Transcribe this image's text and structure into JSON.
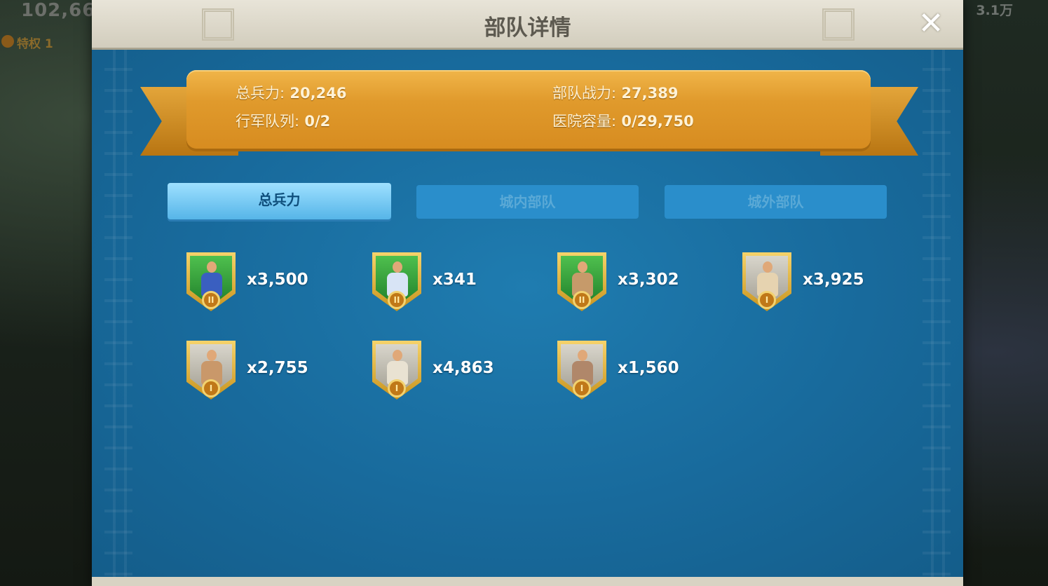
{
  "background": {
    "resource_value": "102,66",
    "vip_label": "特权 1",
    "right_value": "3.1万"
  },
  "modal": {
    "title": "部队详情",
    "close_glyph": "✕"
  },
  "summary": {
    "total_troops_label": "总兵力:",
    "total_troops_value": "20,246",
    "power_label": "部队战力:",
    "power_value": "27,389",
    "march_queue_label": "行军队列:",
    "march_queue_value": "0/2",
    "hospital_label": "医院容量:",
    "hospital_value": "0/29,750"
  },
  "tabs": [
    {
      "label": "总兵力",
      "active": true
    },
    {
      "label": "城内部队",
      "active": false
    },
    {
      "label": "城外部队",
      "active": false
    }
  ],
  "troops": [
    {
      "count": "x3,500",
      "tier": "II",
      "portrait": "green",
      "icon": "infantry-icon",
      "torso_color": "#3a5fc0"
    },
    {
      "count": "x341",
      "tier": "II",
      "portrait": "green",
      "icon": "cavalry-icon",
      "torso_color": "#d8e4f6"
    },
    {
      "count": "x3,302",
      "tier": "II",
      "portrait": "green",
      "icon": "archer-icon",
      "torso_color": "#c69a6a"
    },
    {
      "count": "x3,925",
      "tier": "I",
      "portrait": "gray",
      "icon": "infantry-icon",
      "torso_color": "#e6d3b0"
    },
    {
      "count": "x2,755",
      "tier": "I",
      "portrait": "gray",
      "icon": "cavalry-icon",
      "torso_color": "#c9986a"
    },
    {
      "count": "x4,863",
      "tier": "I",
      "portrait": "gray",
      "icon": "archer-icon",
      "torso_color": "#e9e2d2"
    },
    {
      "count": "x1,560",
      "tier": "I",
      "portrait": "gray",
      "icon": "siege-icon",
      "torso_color": "#b0876a"
    }
  ],
  "colors": {
    "panel_blue": "#1b6a9a",
    "ribbon_gold": "#e09a2c",
    "tab_active": "#56b5e8",
    "tab_inactive": "#2a8ecb"
  }
}
